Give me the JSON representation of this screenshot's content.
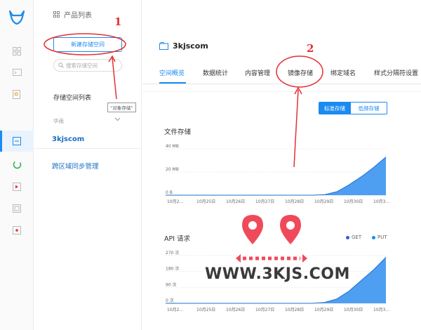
{
  "breadcrumb": "产品列表",
  "sidebar": {
    "new_bucket": "新建存储空间",
    "search_placeholder": "搜索存储空间",
    "list_title": "存储空间列表",
    "region": "华南",
    "bucket": "3kjscom",
    "sync": "跨区域同步管理",
    "tooltip": "对象存储"
  },
  "header": {
    "bucket_name": "3kjscom"
  },
  "tabs": [
    "空间概览",
    "数据统计",
    "内容管理",
    "镜像存储",
    "绑定域名",
    "样式分隔符设置"
  ],
  "active_tab": 0,
  "storage_type": {
    "standard": "标准存储",
    "low": "低频存储",
    "selected": "standard"
  },
  "annotations": {
    "n1": "1",
    "n2": "2"
  },
  "watermark": "WWW.3KJS.COM",
  "colors": {
    "accent": "#1a8bf0",
    "annotation": "#e53030",
    "area": "#2f8ef0"
  },
  "chart_data": [
    {
      "type": "area",
      "title": "文件存储",
      "y_ticks": [
        "40 MB",
        "20 MB",
        "0 B"
      ],
      "ylim": [
        0,
        40
      ],
      "y_unit": "MB",
      "x_ticks": [
        "10月2...",
        "10月25日",
        "10月26日",
        "10月27日",
        "10月28日",
        "10月29日",
        "10月30日",
        "10月3..."
      ],
      "series": [
        {
          "values": [
            0,
            0,
            0,
            0,
            0,
            0,
            0,
            0,
            0,
            0,
            0,
            0,
            0,
            0.5,
            3,
            9,
            16,
            24,
            33
          ]
        }
      ]
    },
    {
      "type": "area",
      "title": "API 请求",
      "legend": [
        "GET",
        "PUT"
      ],
      "y_ticks": [
        "270 次",
        "180 次",
        "90 次",
        "0 次"
      ],
      "ylim": [
        0,
        270
      ],
      "y_unit": "次",
      "x_ticks": [
        "10月2...",
        "10月25日",
        "10月26日",
        "10月27日",
        "10月28日",
        "10月29日",
        "10月30日",
        "10月3..."
      ],
      "series": [
        {
          "values": [
            0,
            0,
            0,
            0,
            0,
            0,
            0,
            0,
            0,
            0,
            0,
            0,
            0,
            5,
            25,
            70,
            130,
            190,
            260
          ]
        }
      ]
    }
  ]
}
